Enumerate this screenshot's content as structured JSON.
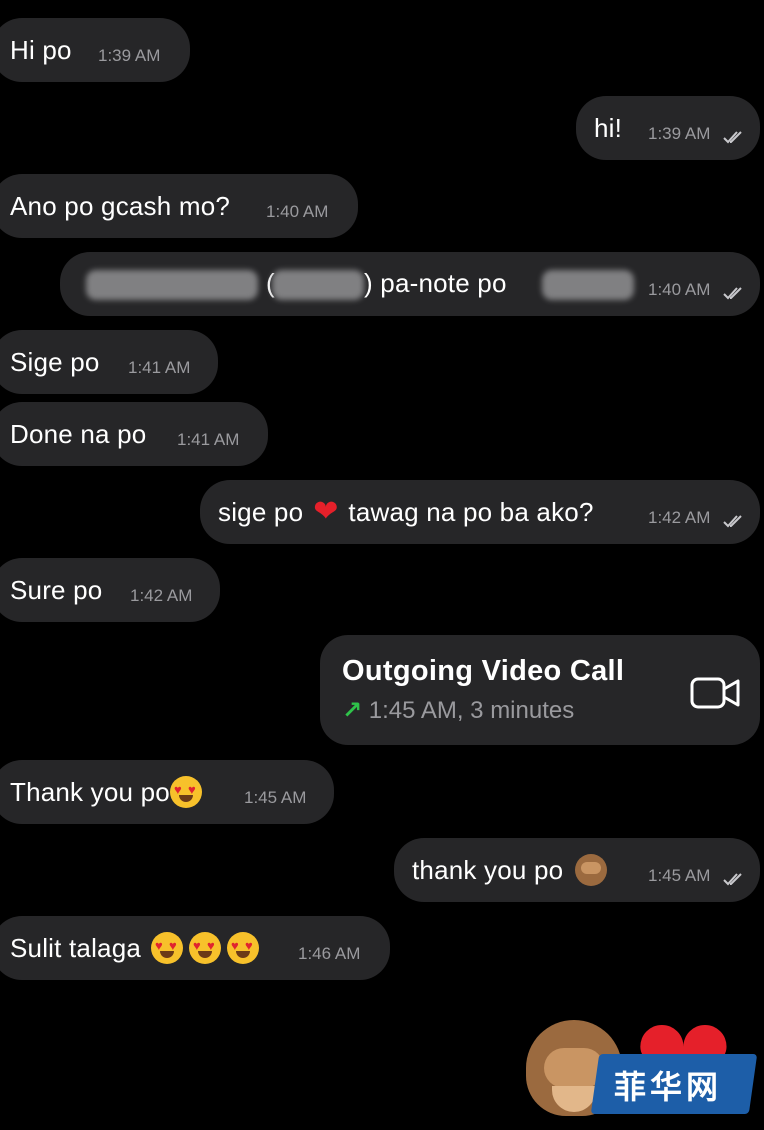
{
  "messages": [
    {
      "text": "Hi po",
      "time": "1:39 AM"
    },
    {
      "text": "hi!",
      "time": "1:39 AM"
    },
    {
      "text": "Ano po gcash mo?",
      "time": "1:40 AM"
    },
    {
      "text_a": "(",
      "text_b": ") pa-note po",
      "time": "1:40 AM"
    },
    {
      "text": "Sige po",
      "time": "1:41 AM"
    },
    {
      "text": "Done na po",
      "time": "1:41 AM"
    },
    {
      "text_a": "sige po",
      "text_b": "tawag na po ba ako?",
      "time": "1:42 AM"
    },
    {
      "text": "Sure po",
      "time": "1:42 AM"
    },
    {
      "text": "Thank you po",
      "time": "1:45 AM"
    },
    {
      "text": "thank you po",
      "time": "1:45 AM"
    },
    {
      "text": "Sulit talaga",
      "time": "1:46 AM"
    }
  ],
  "call": {
    "title": "Outgoing Video Call",
    "arrow": "↗",
    "detail": "1:45 AM, 3 minutes",
    "icon": "video-camera-icon"
  },
  "watermark": {
    "text": "菲华网",
    "color": "#1d5ea8"
  },
  "colors": {
    "bubble": "#262628",
    "background": "#000000",
    "time": "#9a9a9e",
    "call_arrow": "#2fc34a"
  }
}
